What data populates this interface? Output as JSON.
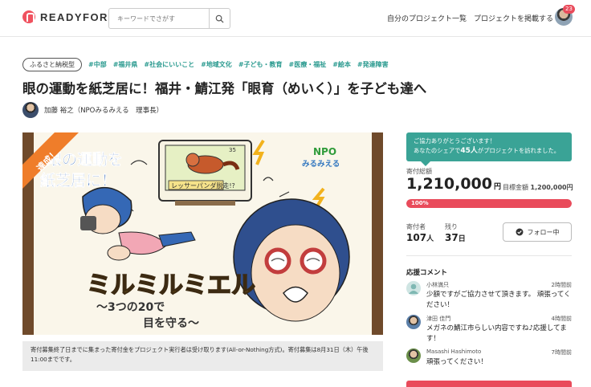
{
  "header": {
    "logo_text": "READYFOR",
    "search_placeholder": "キーワードでさがす",
    "nav_my_projects": "自分のプロジェクト一覧",
    "nav_post_project": "プロジェクトを掲載する",
    "notification_count": "23"
  },
  "project": {
    "tax_badge": "ふるさと納税型",
    "tags": [
      "#中部",
      "#福井県",
      "#社会にいいこと",
      "#地域文化",
      "#子ども・教育",
      "#医療・福祉",
      "#絵本",
      "#発達障害"
    ],
    "title": "眼の運動を紙芝居に！福井・鯖江発「眼育（めいく）」を子ども達へ",
    "owner": "加藤 裕之（NPOみるみえる　理事長）"
  },
  "hero": {
    "ribbon": "達成！",
    "heading_line1": "眼の運動を",
    "heading_line2": "紙芝居に！",
    "tv_label": "レッサーパンダ脱走!?",
    "tv_number": "35",
    "npo_logo_1": "NPO",
    "npo_logo_2": "みるみえる",
    "main_title": "ミルミルミエル",
    "subtitle_line1": "〜3つの20で",
    "subtitle_line2": "目を守る〜"
  },
  "notice": "寄付募集終了日までに集まった寄付金をプロジェクト実行者は受け取ります(All-or-Nothing方式)。寄付募集は8月31日（木）午後11:00までです。",
  "share_box": {
    "line1": "ご協力ありがとうございます！",
    "line2_prefix": "あなたのシェアで",
    "line2_count": "45人",
    "line2_suffix": "がプロジェクトを訪れました。"
  },
  "funding": {
    "label": "寄付総額",
    "amount": "1,210,000",
    "unit": "円",
    "goal_label": "目標金額",
    "goal_amount": "1,200,000円",
    "progress_percent": 100,
    "progress_label": "100%"
  },
  "stats": {
    "supporters_label": "寄付者",
    "supporters_value": "107",
    "supporters_unit": "人",
    "remaining_label": "残り",
    "remaining_value": "37",
    "remaining_unit": "日",
    "follow_label": "フォロー中"
  },
  "comments": {
    "title": "応援コメント",
    "items": [
      {
        "name": "小林満只",
        "time": "2時間前",
        "text": "少額ですがご協力させて頂きます。 頑張ってください！"
      },
      {
        "name": "津田 佳門",
        "time": "4時間前",
        "text": "メガネの鯖江市らしい内容ですね♪応援してます！"
      },
      {
        "name": "Masashi Hashimoto",
        "time": "7時間前",
        "text": "頑張ってください！"
      }
    ]
  },
  "colors": {
    "brand": "#e94b5b",
    "accent": "#3aa396",
    "tag": "#2a9a8f"
  }
}
